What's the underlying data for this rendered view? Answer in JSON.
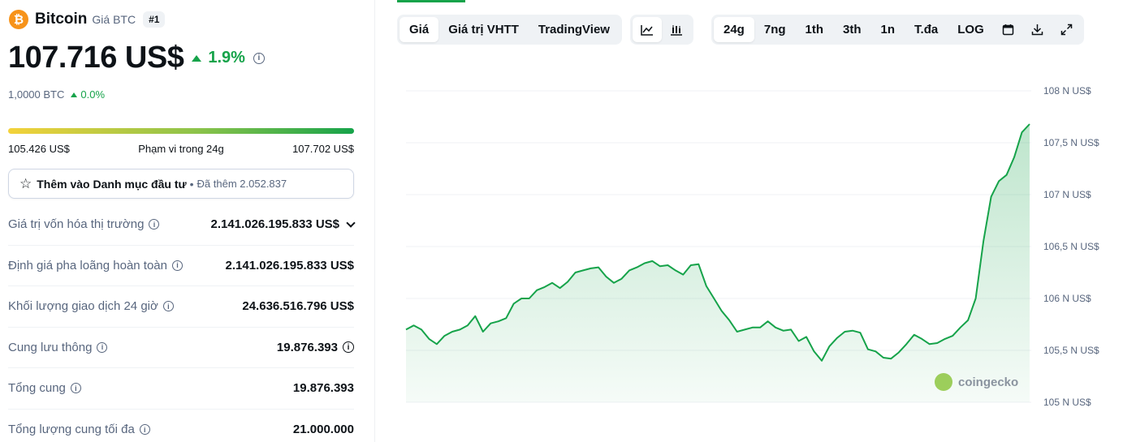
{
  "coin": {
    "name": "Bitcoin",
    "subtitle": "Giá BTC",
    "rank": "#1",
    "logo_symbol": "₿",
    "price": "107.716 US$",
    "change_pct": "1.9%",
    "btc_amount": "1,0000 BTC",
    "btc_change": "0.0%"
  },
  "range": {
    "low": "105.426 US$",
    "label": "Phạm vi trong 24g",
    "high": "107.702 US$"
  },
  "watchlist": {
    "label": "Thêm vào Danh mục đầu tư",
    "separator": "•",
    "count_text": "Đã thêm 2.052.837"
  },
  "stats": [
    {
      "label": "Giá trị vốn hóa thị trường",
      "value": "2.141.026.195.833 US$",
      "has_chevron": true
    },
    {
      "label": "Định giá pha loãng hoàn toàn",
      "value": "2.141.026.195.833 US$"
    },
    {
      "label": "Khối lượng giao dịch 24 giờ",
      "value": "24.636.516.796 US$"
    },
    {
      "label": "Cung lưu thông",
      "value": "19.876.393",
      "value_info": true
    },
    {
      "label": "Tổng cung",
      "value": "19.876.393"
    },
    {
      "label": "Tổng lượng cung tối đa",
      "value": "21.000.000"
    }
  ],
  "chart_tabs": [
    {
      "label": "Giá",
      "active": true
    },
    {
      "label": "Giá trị VHTT"
    },
    {
      "label": "TradingView"
    }
  ],
  "chart_type_icons": [
    "line-chart-icon",
    "candlestick-icon"
  ],
  "ranges": [
    {
      "label": "24g",
      "active": true
    },
    {
      "label": "7ng"
    },
    {
      "label": "1th"
    },
    {
      "label": "3th"
    },
    {
      "label": "1n"
    },
    {
      "label": "T.đa"
    },
    {
      "label": "LOG"
    }
  ],
  "tool_icons": [
    "calendar-icon",
    "download-icon",
    "expand-icon"
  ],
  "watermark": "coingecko",
  "colors": {
    "accent": "#16a34a",
    "fill": "#d8f0dc"
  },
  "chart_data": {
    "type": "area",
    "y_ticks": [
      "108 N US$",
      "107,5 N US$",
      "107 N US$",
      "106,5 N US$",
      "106 N US$",
      "105,5 N US$",
      "105 N US$"
    ],
    "y_tick_values": [
      108000,
      107500,
      107000,
      106500,
      106000,
      105500,
      105000
    ],
    "ylim": [
      105000,
      108000
    ],
    "grid": true,
    "values": [
      105700,
      105740,
      105700,
      105610,
      105560,
      105640,
      105680,
      105700,
      105740,
      105830,
      105680,
      105760,
      105780,
      105810,
      105950,
      106000,
      106000,
      106080,
      106110,
      106150,
      106100,
      106160,
      106250,
      106270,
      106290,
      106300,
      106210,
      106150,
      106190,
      106270,
      106300,
      106340,
      106360,
      106310,
      106320,
      106270,
      106230,
      106320,
      106330,
      106120,
      106000,
      105880,
      105790,
      105680,
      105700,
      105720,
      105720,
      105780,
      105720,
      105690,
      105700,
      105590,
      105630,
      105490,
      105400,
      105540,
      105620,
      105680,
      105690,
      105670,
      105510,
      105490,
      105430,
      105420,
      105480,
      105560,
      105650,
      105610,
      105560,
      105570,
      105610,
      105640,
      105720,
      105790,
      106000,
      106550,
      106980,
      107130,
      107190,
      107360,
      107600,
      107680
    ]
  }
}
